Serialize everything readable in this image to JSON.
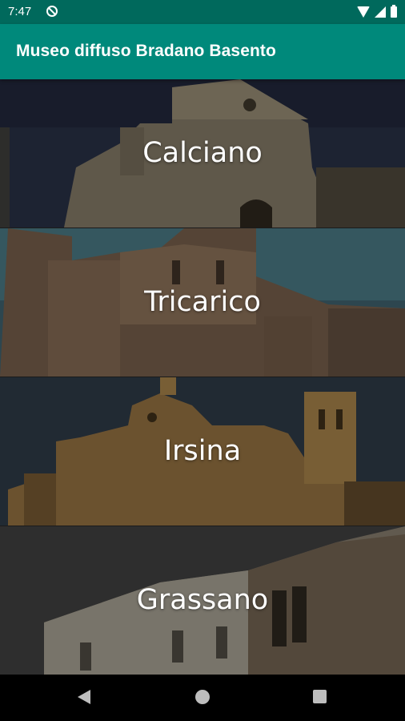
{
  "status_bar": {
    "time": "7:47",
    "icons": [
      "app-notification-icon",
      "wifi-icon",
      "signal-icon",
      "battery-icon"
    ]
  },
  "app_bar": {
    "title": "Museo diffuso Bradano Basento",
    "color": "#00897b",
    "status_color": "#00695c"
  },
  "towns": [
    {
      "name": "Calciano"
    },
    {
      "name": "Tricarico"
    },
    {
      "name": "Irsina"
    },
    {
      "name": "Grassano"
    }
  ],
  "nav_bar": {
    "icons": [
      "back-icon",
      "home-icon",
      "recents-icon"
    ]
  }
}
